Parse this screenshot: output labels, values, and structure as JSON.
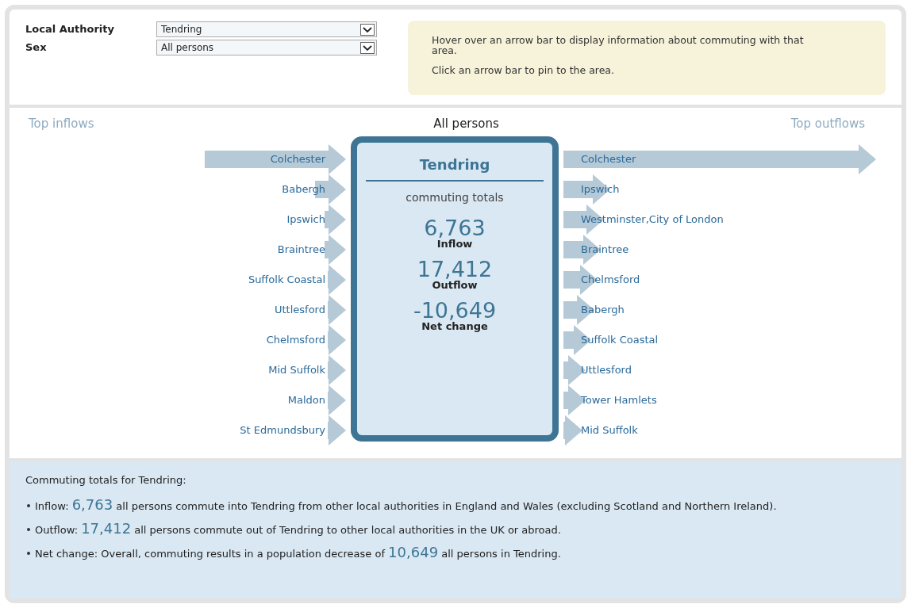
{
  "filters": [
    {
      "label": "Local Authority",
      "value": "Tendring"
    },
    {
      "label": "Sex",
      "value": "All persons"
    }
  ],
  "info": {
    "lines": [
      "Hover over an arrow bar to display information about commuting with that area.",
      "Click an arrow bar to pin to the area."
    ]
  },
  "flows": {
    "inflows_heading": "Top inflows",
    "title": "All persons",
    "outflows_heading": "Top outflows",
    "inflows": [
      {
        "name": "Colchester"
      },
      {
        "name": "Babergh"
      },
      {
        "name": "Ipswich"
      },
      {
        "name": "Braintree"
      },
      {
        "name": "Suffolk Coastal"
      },
      {
        "name": "Uttlesford"
      },
      {
        "name": "Chelmsford"
      },
      {
        "name": "Mid Suffolk"
      },
      {
        "name": "Maldon"
      },
      {
        "name": "St Edmundsbury"
      }
    ],
    "outflows": [
      {
        "name": "Colchester"
      },
      {
        "name": "Ipswich"
      },
      {
        "name": "Westminster,City of London"
      },
      {
        "name": "Braintree"
      },
      {
        "name": "Chelmsford"
      },
      {
        "name": "Babergh"
      },
      {
        "name": "Suffolk Coastal"
      },
      {
        "name": "Uttlesford"
      },
      {
        "name": "Tower Hamlets"
      },
      {
        "name": "Mid Suffolk"
      }
    ]
  },
  "summary_box": {
    "area": "Tendring",
    "subtitle": "commuting totals",
    "totals": [
      {
        "value": "6,763",
        "label": "Inflow"
      },
      {
        "value": "17,412",
        "label": "Outflow"
      },
      {
        "value": "-10,649",
        "label": "Net change"
      }
    ]
  },
  "details": {
    "heading": "Commuting totals for Tendring:",
    "items": [
      {
        "lead": "Inflow:",
        "value": "6,763",
        "rest": "all persons commute into Tendring from other local authorities in England and Wales (excluding Scotland and Northern Ireland)."
      },
      {
        "lead": "Outflow:",
        "value": "17,412",
        "rest": "all persons commute out of Tendring to other local authorities in the UK or abroad."
      },
      {
        "lead": "Net change: Overall, commuting results in a population decrease of",
        "value": "10,649",
        "rest": "all persons in Tendring."
      }
    ]
  }
}
